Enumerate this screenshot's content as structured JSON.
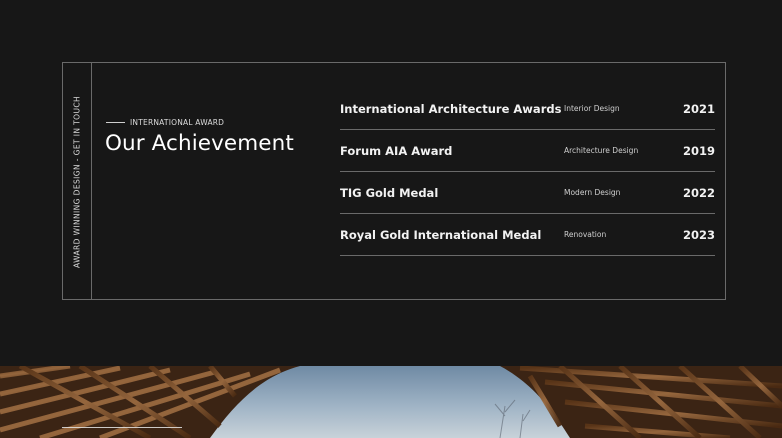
{
  "side_label": "AWARD WINNING DESIGN - GET IN TOUCH",
  "section": {
    "eyebrow": "INTERNATIONAL AWARD",
    "title": "Our Achievement"
  },
  "awards": [
    {
      "name": "International Architecture Awards",
      "category": "Interior Design",
      "year": "2021"
    },
    {
      "name": "Forum AIA Award",
      "category": "Architecture Design",
      "year": "2019"
    },
    {
      "name": "TIG Gold Medal",
      "category": "Modern Design",
      "year": "2022"
    },
    {
      "name": "Royal Gold International Medal",
      "category": "Renovation",
      "year": "2023"
    }
  ],
  "colors": {
    "background": "#171717",
    "border": "#6a6a6a",
    "text": "#f2f2f2",
    "wood": "#7a4e2c",
    "sky": "#9fb3c5"
  }
}
